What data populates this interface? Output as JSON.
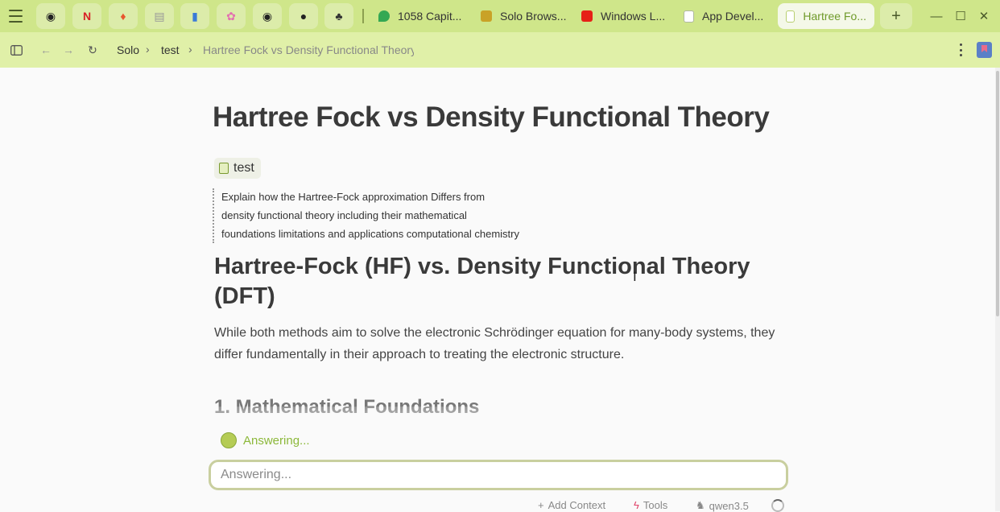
{
  "colors": {
    "tabbar_bg": "#cfe68a",
    "navbar_bg": "#e0f0a8",
    "accent": "#8cb83a"
  },
  "pinned_tabs": [
    {
      "name": "github-icon",
      "glyph": "◉",
      "color": "#222"
    },
    {
      "name": "netflix-icon",
      "glyph": "N",
      "color": "#d81f26"
    },
    {
      "name": "brave-icon",
      "glyph": "♦",
      "color": "#e8562f"
    },
    {
      "name": "notes-icon",
      "glyph": "▤",
      "color": "#999"
    },
    {
      "name": "book-icon",
      "glyph": "▮",
      "color": "#3a7ad8"
    },
    {
      "name": "flower-icon",
      "glyph": "✿",
      "color": "#e36fb0"
    },
    {
      "name": "github-icon",
      "glyph": "◉",
      "color": "#222"
    },
    {
      "name": "lightbulb-icon",
      "glyph": "●",
      "color": "#222"
    },
    {
      "name": "ai-assistant-icon",
      "glyph": "♣",
      "color": "#333"
    }
  ],
  "tabs": [
    {
      "label": "1058 Capit...",
      "icon": "maps-pin-icon",
      "color": "#34a853"
    },
    {
      "label": "Solo Brows...",
      "icon": "solo-icon",
      "color": "#c9a227"
    },
    {
      "label": "Windows L...",
      "icon": "youtube-icon",
      "color": "#e62117"
    },
    {
      "label": "App Devel...",
      "icon": "document-icon",
      "color": "#b0b8a0"
    },
    {
      "label": "Hartree Fo...",
      "icon": "document-icon",
      "color": "#b8cf70",
      "active": true
    }
  ],
  "new_tab_label": "+",
  "breadcrumb": {
    "root": "Solo",
    "folder": "test",
    "page": "Hartree Fock vs Density Functional Theory",
    "sep": "›"
  },
  "page": {
    "title": "Hartree Fock vs Density Functional Theory",
    "tag": "test",
    "prompt_lines": [
      "Explain how the Hartree-Fock approximation Differs from",
      "density functional theory including their mathematical",
      "foundations limitations and applications computational chemistry"
    ],
    "heading": "Hartree-Fock (HF) vs. Density Functional Theory (DFT)",
    "paragraph": "While both methods aim to solve the electronic Schrödinger equation for many-body systems, they differ fundamentally in their approach to treating the electronic structure.",
    "section": "1. Mathematical Foundations"
  },
  "assistant": {
    "status": "Answering...",
    "input_placeholder": "Answering...",
    "add_context": "Add Context",
    "tools": "Tools",
    "model": "qwen3.5"
  }
}
